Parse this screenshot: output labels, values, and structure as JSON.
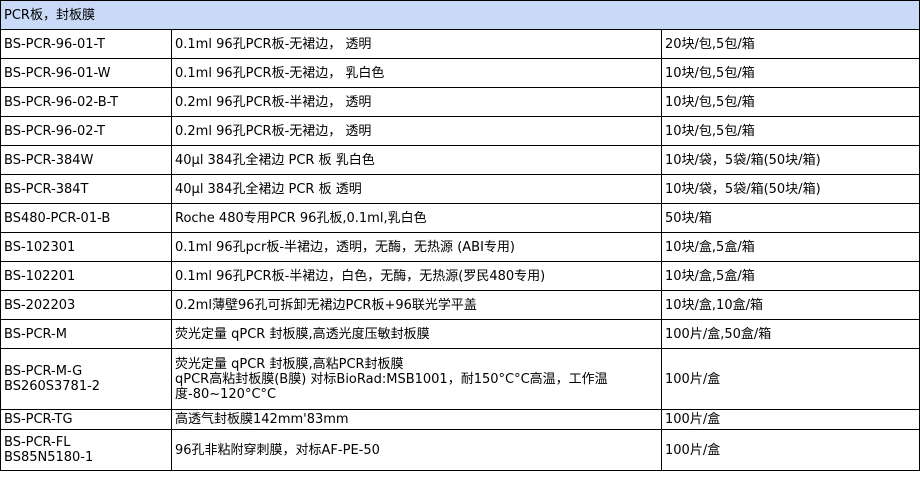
{
  "header": "PCR板，封板膜",
  "rows": [
    {
      "code": [
        "BS-PCR-96-01-T"
      ],
      "desc": [
        "0.1ml 96孔PCR板-无裙边， 透明"
      ],
      "pack": "20块/包,5包/箱"
    },
    {
      "code": [
        "BS-PCR-96-01-W"
      ],
      "desc": [
        "0.1ml 96孔PCR板-无裙边， 乳白色"
      ],
      "pack": "10块/包,5包/箱"
    },
    {
      "code": [
        "BS-PCR-96-02-B-T"
      ],
      "desc": [
        "0.2ml 96孔PCR板-半裙边， 透明"
      ],
      "pack": "10块/包,5包/箱"
    },
    {
      "code": [
        "BS-PCR-96-02-T"
      ],
      "desc": [
        "0.2ml 96孔PCR板-无裙边， 透明"
      ],
      "pack": "10块/包,5包/箱"
    },
    {
      "code": [
        "BS-PCR-384W"
      ],
      "desc": [
        "40μl 384孔全裙边 PCR 板 乳白色"
      ],
      "pack": "10块/袋，5袋/箱(50块/箱)"
    },
    {
      "code": [
        "BS-PCR-384T"
      ],
      "desc": [
        "40μl 384孔全裙边 PCR 板 透明"
      ],
      "pack": "10块/袋，5袋/箱(50块/箱)"
    },
    {
      "code": [
        "BS480-PCR-01-B"
      ],
      "desc": [
        "Roche 480专用PCR 96孔板,0.1ml,乳白色"
      ],
      "pack": "50块/箱"
    },
    {
      "code": [
        "BS-102301"
      ],
      "desc": [
        "0.1ml 96孔pcr板-半裙边，透明，无酶，无热源 (ABI专用)"
      ],
      "pack": "10块/盒,5盒/箱"
    },
    {
      "code": [
        "BS-102201"
      ],
      "desc": [
        "0.1ml 96孔PCR板-半裙边，白色，无酶，无热源(罗民480专用)"
      ],
      "pack": "10块/盒,5盒/箱"
    },
    {
      "code": [
        "BS-202203"
      ],
      "desc": [
        "0.2ml薄壁96孔可拆卸无裙边PCR板+96联光学平盖"
      ],
      "pack": "10块/盒,10盒/箱"
    },
    {
      "code": [
        "BS-PCR-M"
      ],
      "desc": [
        "荧光定量 qPCR 封板膜,高透光度压敏封板膜"
      ],
      "pack": "100片/盒,50盒/箱"
    },
    {
      "code": [
        "BS-PCR-M-G",
        "BS260S3781-2"
      ],
      "desc": [
        "荧光定量 qPCR 封板膜,高粘PCR封板膜",
        "qPCR高粘封板膜(B膜) 对标BioRad:MSB1001，耐150°C°C高温，工作温",
        "度-80~120°C°C"
      ],
      "pack": "100片/盒"
    },
    {
      "code": [
        "BS-PCR-TG"
      ],
      "desc": [
        "高透气封板膜142mm'83mm"
      ],
      "pack": "100片/盒"
    },
    {
      "code": [
        "BS-PCR-FL",
        "BS85N5180-1"
      ],
      "desc": [
        "96孔非粘附穿刺膜，对标AF-PE-50"
      ],
      "pack": "100片/盒"
    }
  ]
}
